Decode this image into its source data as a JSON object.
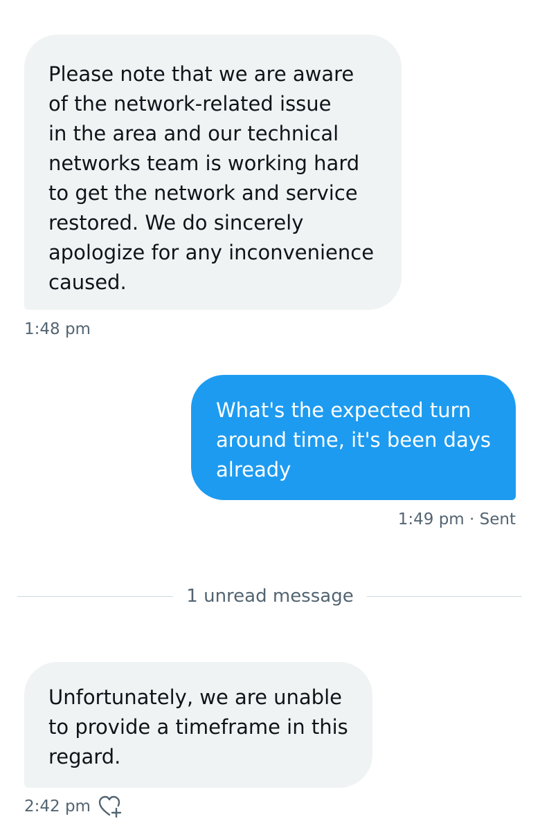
{
  "conversation": {
    "messages": [
      {
        "direction": "incoming",
        "text": "Please note that we are aware\nof the network-related issue\nin the area and our technical\nnetworks team is working hard\nto get the network and service\nrestored. We do sincerely\napologize for any inconvenience\ncaused.",
        "time": "1:48 pm"
      },
      {
        "direction": "outgoing",
        "text": "What's the expected turn\naround time, it's been days\nalready",
        "time": "1:49 pm",
        "status": "Sent",
        "separator": "·"
      },
      {
        "direction": "incoming",
        "text": "Unfortunately, we are unable\nto provide a timeframe in this\nregard.",
        "time": "2:42 pm",
        "reaction_icon": "heart-plus-icon"
      }
    ],
    "unread_divider": {
      "label": "1 unread message"
    }
  },
  "colors": {
    "incoming_bubble": "#eff3f4",
    "outgoing_bubble": "#1d9bf0",
    "meta_text": "#536471",
    "divider": "#cfd9de"
  }
}
